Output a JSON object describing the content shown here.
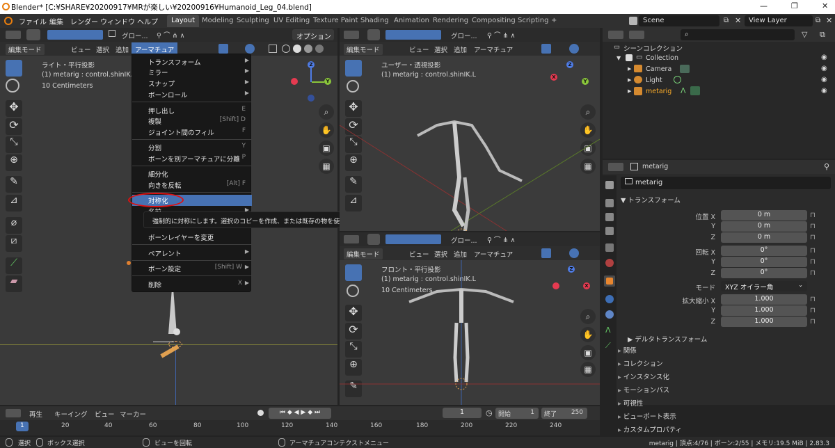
{
  "window": {
    "title": "Blender* [C:¥SHARE¥20200917¥MRが楽しい¥20200916¥Humanoid_Leg_04.blend]",
    "minimize": "—",
    "maximize": "❐",
    "close": "✕"
  },
  "menubar": {
    "items": [
      "ファイル",
      "編集",
      "レンダー",
      "ウィンドウ",
      "ヘルプ"
    ]
  },
  "workspaces": {
    "tabs": [
      "Layout",
      "Modeling",
      "Sculpting",
      "UV Editing",
      "Texture Paint",
      "Shading",
      "Animation",
      "Rendering",
      "Compositing",
      "Scripting"
    ],
    "add": "+"
  },
  "scene": {
    "name": "Scene",
    "view_layer": "View Layer"
  },
  "viewport_left": {
    "transform": "グロー...",
    "options": "オプション",
    "mode": "編集モード",
    "menus": [
      "ビュー",
      "選択",
      "追加",
      "アーマチュア"
    ],
    "view_name": "ライト・平行投影",
    "object": "(1) metarig : control.shinIK.L",
    "scale": "10 Centimeters"
  },
  "viewport_tr": {
    "transform": "グロー...",
    "mode": "編集モード",
    "menus": [
      "ビュー",
      "選択",
      "追加",
      "アーマチュア"
    ],
    "view_name": "ユーザー・透視投影",
    "object": "(1) metarig : control.shinIK.L"
  },
  "viewport_br": {
    "transform": "グロー...",
    "mode": "編集モード",
    "menus": [
      "ビュー",
      "選択",
      "追加",
      "アーマチュア"
    ],
    "view_name": "フロント・平行投影",
    "object": "(1) metarig : control.shinIK.L",
    "scale": "10 Centimeters"
  },
  "gizmo": {
    "x": "X",
    "y": "Y",
    "z": "Z"
  },
  "armature_menu": {
    "items": [
      {
        "label": "トランスフォーム",
        "shortcut": "",
        "submenu": true
      },
      {
        "label": "ミラー",
        "shortcut": "",
        "submenu": true
      },
      {
        "label": "スナップ",
        "shortcut": "",
        "submenu": true
      },
      {
        "label": "ボーンロール",
        "shortcut": "",
        "submenu": true
      },
      {
        "label": "押し出し",
        "shortcut": "E",
        "submenu": false
      },
      {
        "label": "複製",
        "shortcut": "[Shift] D",
        "submenu": false
      },
      {
        "label": "ジョイント間のフィル",
        "shortcut": "F",
        "submenu": false
      },
      {
        "label": "分割",
        "shortcut": "Y",
        "submenu": false
      },
      {
        "label": "ボーンを別アーマチュアに分離",
        "shortcut": "P",
        "submenu": false
      },
      {
        "label": "細分化",
        "shortcut": "",
        "submenu": false
      },
      {
        "label": "向きを反転",
        "shortcut": "[Alt] F",
        "submenu": false
      },
      {
        "label": "対称化",
        "shortcut": "",
        "submenu": false
      },
      {
        "label": "名前",
        "shortcut": "",
        "submenu": true
      },
      {
        "label": "ボーンレイヤーを変更",
        "shortcut": "",
        "submenu": false
      },
      {
        "label": "ペアレント",
        "shortcut": "",
        "submenu": true
      },
      {
        "label": "ボーン設定",
        "shortcut": "[Shift] W",
        "submenu": true
      },
      {
        "label": "削除",
        "shortcut": "X",
        "submenu": true
      }
    ],
    "tooltip": "強制的に対称にします。選択のコピーを作成、または既存の物を使用します: -X → +X"
  },
  "outliner": {
    "root": "シーンコレクション",
    "items": [
      {
        "name": "Collection"
      },
      {
        "name": "Camera"
      },
      {
        "name": "Light"
      },
      {
        "name": "metarig"
      }
    ]
  },
  "properties": {
    "object_name": "metarig",
    "data_name": "metarig",
    "transform_title": "トランスフォーム",
    "location": {
      "label": "位置 X",
      "x": "0 m",
      "y": "0 m",
      "z": "0 m"
    },
    "rotation": {
      "label": "回転 X",
      "x": "0°",
      "y": "0°",
      "z": "0°"
    },
    "mode": {
      "label": "モード",
      "value": "XYZ オイラー角"
    },
    "scale": {
      "label": "拡大縮小 X",
      "x": "1.000",
      "y": "1.000",
      "z": "1.000"
    },
    "axis_y": "Y",
    "axis_z": "Z",
    "delta": "デルタトランスフォーム",
    "panels": [
      "関係",
      "コレクション",
      "インスタンス化",
      "モーションパス",
      "可視性",
      "ビューポート表示",
      "カスタムプロパティ"
    ]
  },
  "timeline": {
    "menus": [
      "再生",
      "キーイング",
      "ビュー",
      "マーカー"
    ],
    "current_frame": "1",
    "start_label": "開始",
    "start": "1",
    "end_label": "終了",
    "end": "250",
    "ticks": [
      "1",
      "20",
      "40",
      "60",
      "80",
      "100",
      "120",
      "140",
      "160",
      "180",
      "200",
      "220",
      "240"
    ]
  },
  "statusbar": {
    "select": "選択",
    "box_select": "ボックス選択",
    "rotate": "ビューを回転",
    "context": "アーマチュアコンテクストメニュー",
    "info": "metarig | 頂点:4/76 | ボーン:2/55 | メモリ:19.5 MiB | 2.83.3"
  }
}
